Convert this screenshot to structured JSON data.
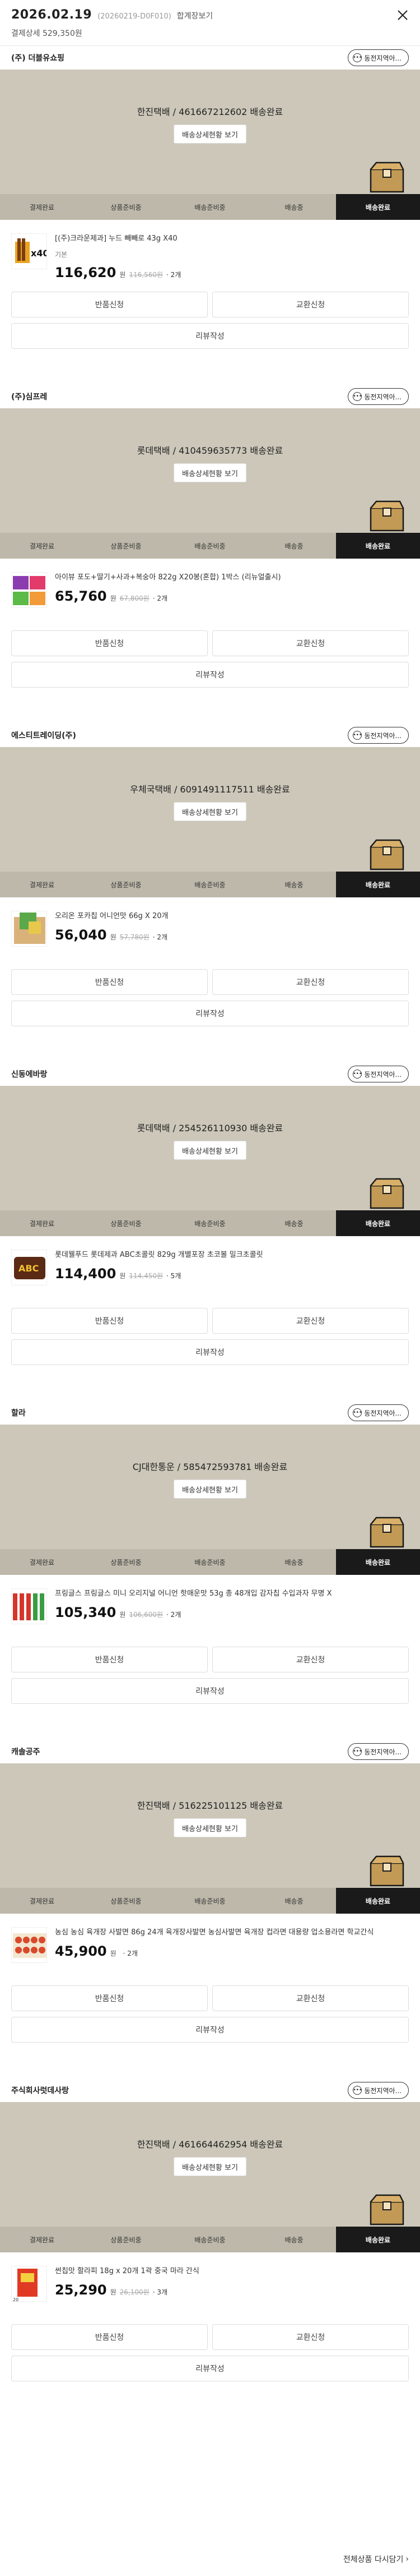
{
  "header": {
    "date": "2026.02.19",
    "order_no": "(20260219-D0F010)",
    "receipt_link": "합계장보기",
    "summary": "결제상세 529,350원"
  },
  "common": {
    "chat_label": "동전지역아...",
    "detail_button": "배송상세현황 보기",
    "return_label": "반품신청",
    "exchange_label": "교환신청",
    "review_label": "리뷰작성",
    "won": "원",
    "steps": [
      "결제완료",
      "상품준비중",
      "배송준비중",
      "배송중",
      "배송완료"
    ],
    "active_step": 4
  },
  "orders": [
    {
      "seller": "(주) 더블유쇼핑",
      "tracking": "한진택배 / 461667212602 배송완료",
      "product_name": "[(주)크라운제과] 누드 빼빼로 43g X40",
      "option": "기본",
      "price": "116,620",
      "orig_price": "116,560원",
      "qty": "· 2개",
      "thumb": "pepero"
    },
    {
      "seller": "(주)심프레",
      "tracking": "롯데택배 / 410459635773 배송완료",
      "product_name": "아이뷰 포도+딸기+사과+복숭아 822g X20봉(혼합) 1박스 (리뉴얼출시)",
      "option": "",
      "price": "65,760",
      "orig_price": "67,800원",
      "qty": "· 2개",
      "thumb": "jelly"
    },
    {
      "seller": "에스티트레이딩(주)",
      "tracking": "우체국택배 / 6091491117511 배송완료",
      "product_name": "오리온 포카칩 어니언맛 66g X 20개",
      "option": "",
      "price": "56,040",
      "orig_price": "57,780원",
      "qty": "· 2개",
      "thumb": "chips"
    },
    {
      "seller": "신동에바랑",
      "tracking": "롯데택배 / 254526110930 배송완료",
      "product_name": "롯데웰푸드 롯데제과 ABC초콜릿 829g 개별포장 초코볼 밀크초콜릿",
      "option": "",
      "price": "114,400",
      "orig_price": "114,450원",
      "qty": "· 5개",
      "thumb": "abc"
    },
    {
      "seller": "할라",
      "tracking": "CJ대한통운 / 585472593781 배송완료",
      "product_name": "프링글스 프링글스 미니 오리지널 어니언 핫매운맛 53g 총 48개입 감자칩 수입과자 무명 X",
      "option": "",
      "price": "105,340",
      "orig_price": "106,600원",
      "qty": "· 2개",
      "thumb": "pringles"
    },
    {
      "seller": "캐솔공주",
      "tracking": "한진택배 / 516225101125 배송완료",
      "product_name": "농심 농심 육개장 사발면 86g 24개 육개장사발면 농심사발면 육개장 컵라면 대용량 업소용라면 학교간식",
      "option": "",
      "price": "45,900",
      "orig_price": "",
      "qty": "· 2개",
      "thumb": "ramen"
    },
    {
      "seller": "주식회사럿데사랑",
      "tracking": "한진택배 / 461664462954 배송완료",
      "product_name": "썬칩맛 할라피 18g x 20개 1곽 중국 마라 간식",
      "option": "",
      "price": "25,290",
      "orig_price": "26,100원",
      "qty": "· 3개",
      "thumb": "mala"
    }
  ],
  "footer": {
    "link": "전체상품 다시담기"
  },
  "colors": {
    "panel": "#ccc7b9",
    "active_step": "#1a1a1a"
  }
}
